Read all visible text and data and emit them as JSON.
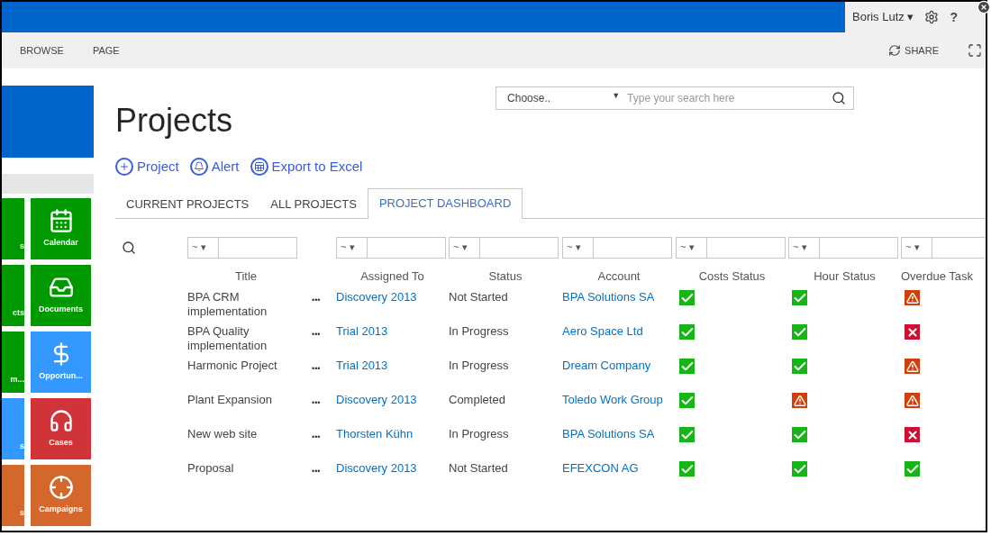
{
  "top_bar": {
    "user": "Boris Lutz",
    "user_caret": "▾",
    "help": "?"
  },
  "ribbon": {
    "tabs": [
      "BROWSE",
      "PAGE"
    ],
    "share": "SHARE"
  },
  "search": {
    "scope": "Choose..",
    "scope_caret": "▼",
    "placeholder": "Type your search here"
  },
  "sidebar": {
    "tiles_left": [
      {
        "label": "s",
        "color": "#009a00"
      },
      {
        "label": "cts",
        "color": "#009a00"
      },
      {
        "label": "m...",
        "color": "#009a00"
      },
      {
        "label": "s",
        "color": "#3399ff"
      },
      {
        "label": "s",
        "color": "#d4682c"
      }
    ],
    "tiles": [
      {
        "label": "Calendar",
        "kind": "calendar",
        "color": "#009a00"
      },
      {
        "label": "Documents",
        "kind": "documents",
        "color": "#009a00"
      },
      {
        "label": "Opportun...",
        "kind": "dollar",
        "color": "#3399ff"
      },
      {
        "label": "Cases",
        "kind": "headset",
        "color": "#d13438"
      },
      {
        "label": "Campaigns",
        "kind": "target",
        "color": "#d4682c"
      }
    ]
  },
  "page_title": "Projects",
  "actions": [
    {
      "label": "Project",
      "kind": "plus"
    },
    {
      "label": "Alert",
      "kind": "bell"
    },
    {
      "label": "Export to Excel",
      "kind": "excel"
    }
  ],
  "tabs": [
    {
      "label": "CURRENT PROJECTS",
      "selected": false
    },
    {
      "label": "ALL PROJECTS",
      "selected": false
    },
    {
      "label": "PROJECT DASHBOARD",
      "selected": true
    }
  ],
  "filter_operator": "~",
  "filter_caret": "▾",
  "table": {
    "columns": [
      "Title",
      "Assigned To",
      "Status",
      "Account",
      "Costs Status",
      "Hour Status",
      "Overdue Task"
    ],
    "row_menu": "•••",
    "rows": [
      {
        "title": "BPA CRM implementation",
        "assigned_to": "Discovery 2013",
        "status": "Not Started",
        "account": "BPA Solutions SA",
        "indicators": [
          {
            "kind": "ok"
          },
          {
            "kind": "ok"
          },
          {
            "kind": "warning"
          }
        ]
      },
      {
        "title": "BPA Quality implementation",
        "assigned_to": "Trial 2013",
        "status": "In Progress",
        "account": "Aero Space Ltd",
        "indicators": [
          {
            "kind": "ok"
          },
          {
            "kind": "ok"
          },
          {
            "kind": "error"
          }
        ]
      },
      {
        "title": "Harmonic Project",
        "assigned_to": "Trial 2013",
        "status": "In Progress",
        "account": "Dream Company",
        "indicators": [
          {
            "kind": "ok"
          },
          {
            "kind": "ok"
          },
          {
            "kind": "warning"
          }
        ]
      },
      {
        "title": "Plant Expansion",
        "assigned_to": "Discovery 2013",
        "status": "Completed",
        "account": "Toledo Work Group",
        "indicators": [
          {
            "kind": "ok"
          },
          {
            "kind": "warning"
          },
          {
            "kind": "warning"
          }
        ]
      },
      {
        "title": "New web site",
        "assigned_to": "Thorsten Kühn",
        "status": "In Progress",
        "account": "BPA Solutions SA",
        "indicators": [
          {
            "kind": "ok"
          },
          {
            "kind": "ok"
          },
          {
            "kind": "error"
          }
        ]
      },
      {
        "title": "Proposal",
        "assigned_to": "Discovery 2013",
        "status": "Not Started",
        "account": "EFEXCON AG",
        "indicators": [
          {
            "kind": "ok"
          },
          {
            "kind": "ok"
          },
          {
            "kind": "ok"
          }
        ]
      }
    ]
  }
}
